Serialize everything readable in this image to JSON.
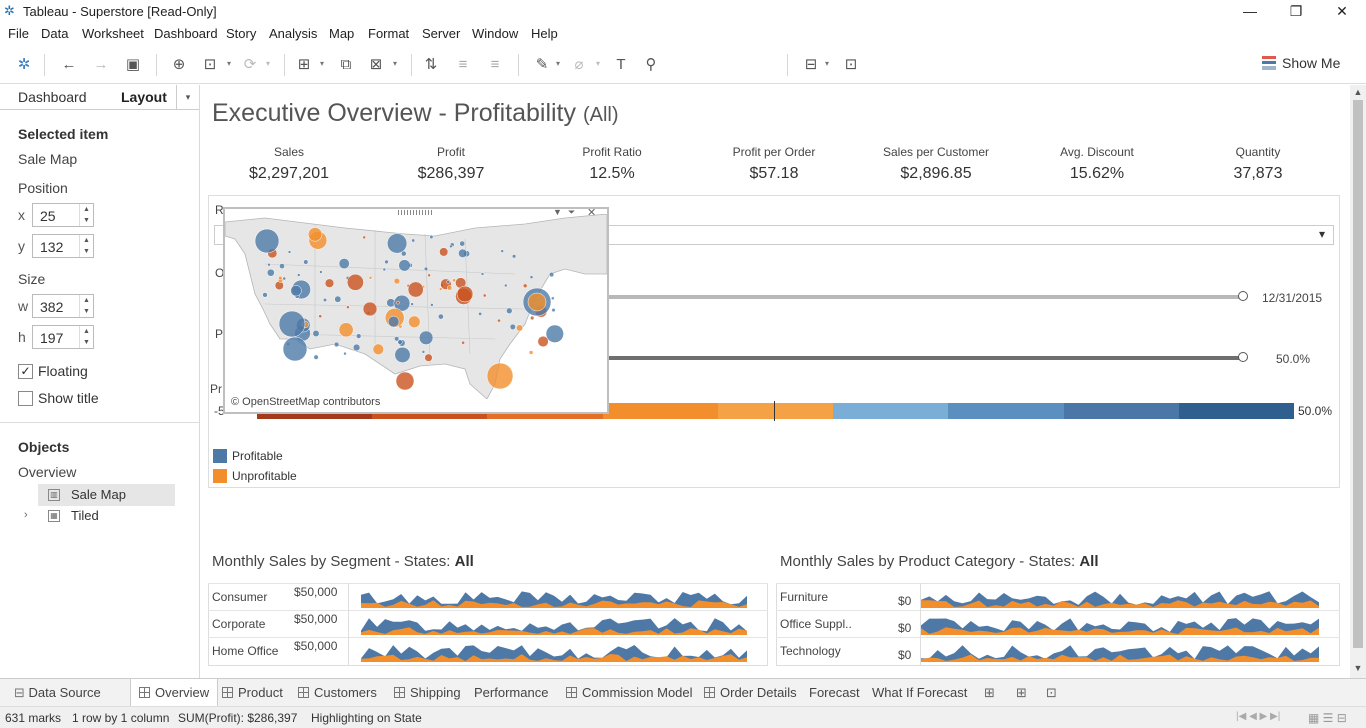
{
  "window": {
    "title": "Tableau - Superstore [Read-Only]"
  },
  "menu": [
    "File",
    "Data",
    "Worksheet",
    "Dashboard",
    "Story",
    "Analysis",
    "Map",
    "Format",
    "Server",
    "Window",
    "Help"
  ],
  "toolbar": {
    "show_me": "Show Me"
  },
  "left_pane": {
    "tabs": {
      "dashboard": "Dashboard",
      "layout": "Layout"
    },
    "selected_item_heading": "Selected item",
    "selected_item_name": "Sale Map",
    "position_label": "Position",
    "x_label": "x",
    "x_value": "25",
    "y_label": "y",
    "y_value": "132",
    "size_label": "Size",
    "w_label": "w",
    "w_value": "382",
    "h_label": "h",
    "h_value": "197",
    "floating_label": "Floating",
    "floating_checked": true,
    "show_title_label": "Show title",
    "show_title_checked": false,
    "objects_heading": "Objects",
    "objects_root": "Overview",
    "objects": [
      "Sale Map",
      "Tiled"
    ]
  },
  "dashboard": {
    "title": "Executive Overview - Profitability",
    "title_suffix": "(All)",
    "kpis": [
      {
        "label": "Sales",
        "value": "$2,297,201"
      },
      {
        "label": "Profit",
        "value": "$286,397"
      },
      {
        "label": "Profit Ratio",
        "value": "12.5%"
      },
      {
        "label": "Profit per Order",
        "value": "$57.18"
      },
      {
        "label": "Sales per Customer",
        "value": "$2,896.85"
      },
      {
        "label": "Avg. Discount",
        "value": "15.62%"
      },
      {
        "label": "Quantity",
        "value": "37,873"
      }
    ],
    "filters": {
      "partial_labels": [
        "R",
        "O",
        "P",
        "Pr",
        "-5"
      ],
      "date_end": "12/31/2015",
      "profit_ratio_value": "50.0%",
      "bar_pct": "50.0%",
      "bar_colors": [
        "#a33a1c",
        "#c9521f",
        "#e46f27",
        "#f28e2b",
        "#f5a247",
        "#7aaed6",
        "#5b8fbf",
        "#4a76a8",
        "#2f5f8f"
      ]
    },
    "legend": [
      {
        "label": "Profitable",
        "color": "#4e79a7"
      },
      {
        "label": "Unprofitable",
        "color": "#f28e2b"
      }
    ],
    "map": {
      "credit": "© OpenStreetMap contributors"
    },
    "segment_chart": {
      "title_prefix": "Monthly Sales by Segment - States:",
      "title_value": "All",
      "rows": [
        {
          "label": "Consumer",
          "axis": "$50,000"
        },
        {
          "label": "Corporate",
          "axis": "$50,000"
        },
        {
          "label": "Home Office",
          "axis": "$50,000"
        }
      ]
    },
    "category_chart": {
      "title_prefix": "Monthly Sales by Product Category - States:",
      "title_value": "All",
      "rows": [
        {
          "label": "Furniture",
          "axis": "$0"
        },
        {
          "label": "Office Suppl..",
          "axis": "$0"
        },
        {
          "label": "Technology",
          "axis": "$0"
        }
      ]
    }
  },
  "sheet_tabs": [
    "Data Source",
    "Overview",
    "Product",
    "Customers",
    "Shipping",
    "Performance",
    "Commission Model",
    "Order Details",
    "Forecast",
    "What If Forecast"
  ],
  "status": {
    "marks": "631 marks",
    "rows": "1 row by 1 column",
    "sum": "SUM(Profit): $286,397",
    "highlight": "Highlighting on State"
  },
  "colors": {
    "profitable": "#4e79a7",
    "unprofitable": "#f28e2b",
    "orange_dark": "#c9521f"
  }
}
